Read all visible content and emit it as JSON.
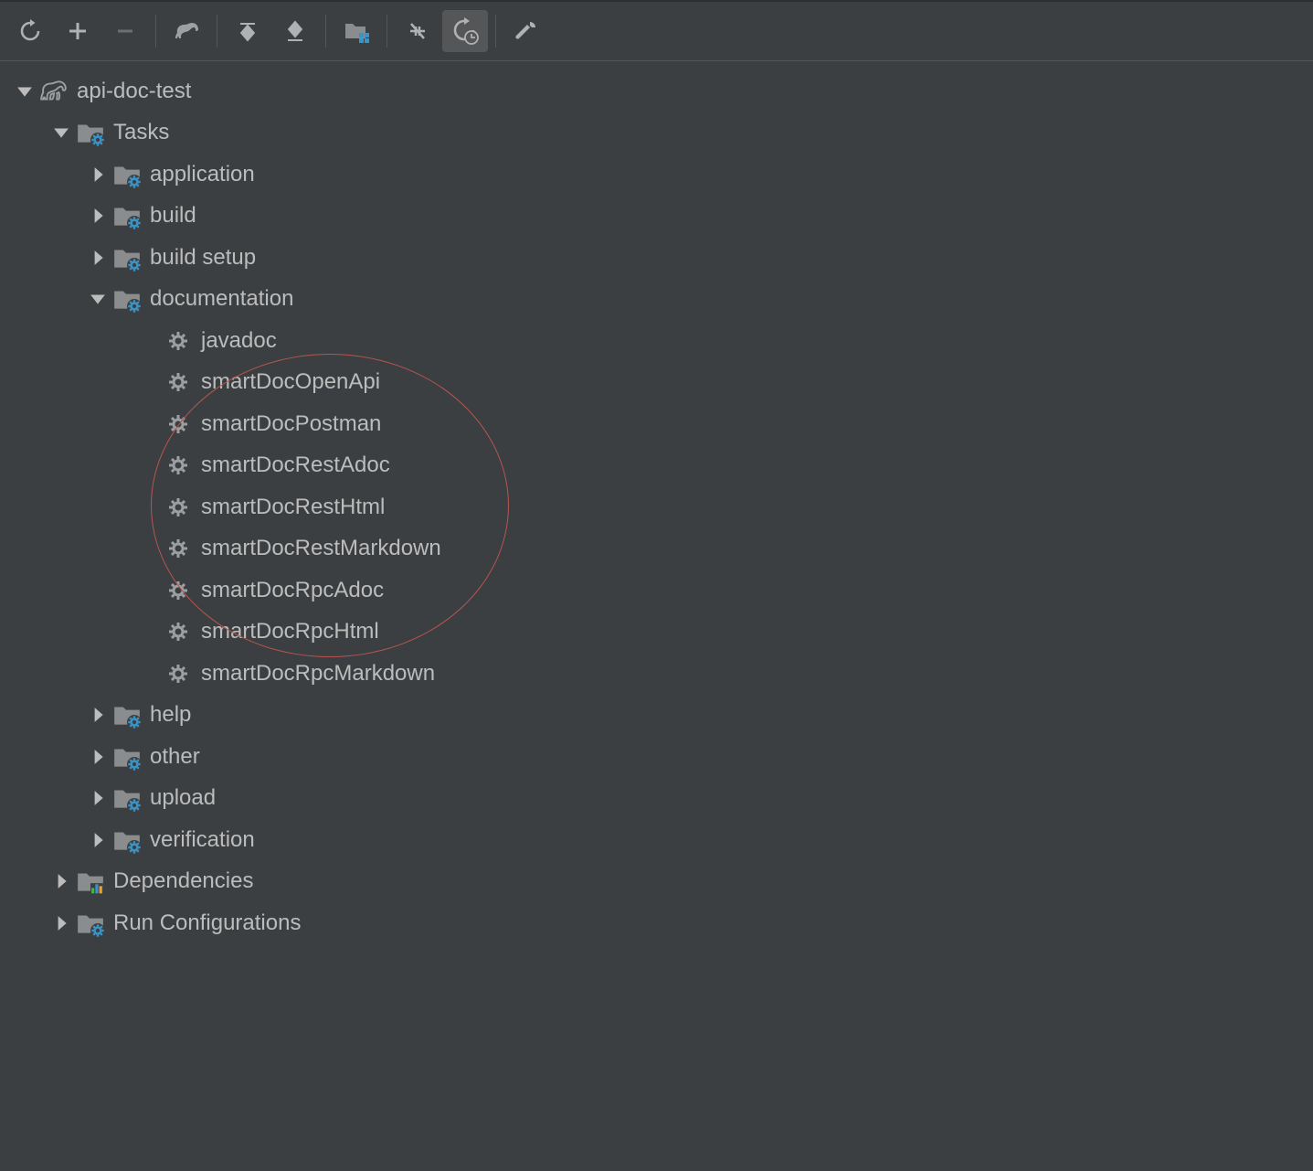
{
  "project": {
    "name": "api-doc-test"
  },
  "tree": {
    "tasks": {
      "label": "Tasks",
      "groups": {
        "application": {
          "label": "application"
        },
        "build": {
          "label": "build"
        },
        "build_setup": {
          "label": "build setup"
        },
        "documentation": {
          "label": "documentation",
          "tasks": [
            {
              "name": "javadoc"
            },
            {
              "name": "smartDocOpenApi"
            },
            {
              "name": "smartDocPostman"
            },
            {
              "name": "smartDocRestAdoc"
            },
            {
              "name": "smartDocRestHtml"
            },
            {
              "name": "smartDocRestMarkdown"
            },
            {
              "name": "smartDocRpcAdoc"
            },
            {
              "name": "smartDocRpcHtml"
            },
            {
              "name": "smartDocRpcMarkdown"
            }
          ]
        },
        "help": {
          "label": "help"
        },
        "other": {
          "label": "other"
        },
        "upload": {
          "label": "upload"
        },
        "verification": {
          "label": "verification"
        }
      }
    },
    "dependencies": {
      "label": "Dependencies"
    },
    "run_configs": {
      "label": "Run Configurations"
    }
  },
  "colors": {
    "accent": "#3b93c5",
    "icon_gray": "#afb1b3"
  }
}
